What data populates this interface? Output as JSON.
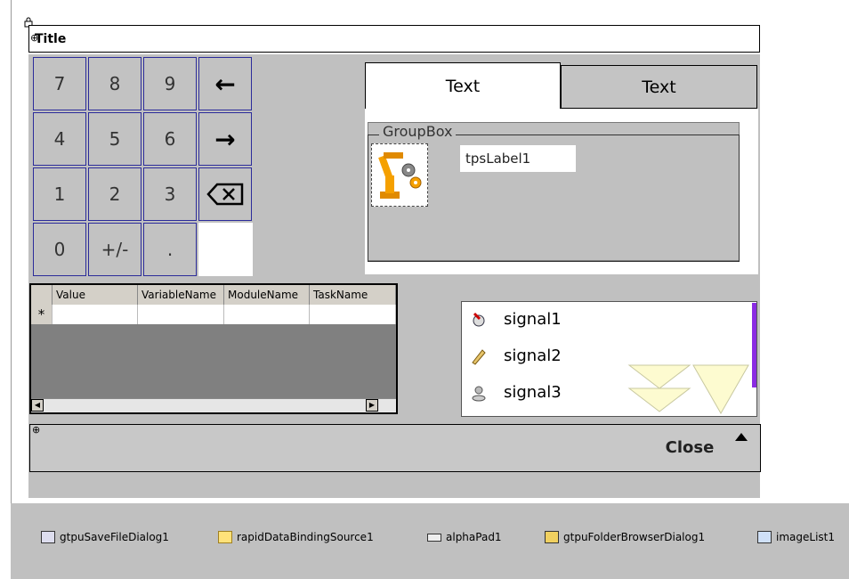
{
  "form": {
    "title": "Title"
  },
  "keypad": {
    "keys": [
      "7",
      "8",
      "9",
      "4",
      "5",
      "6",
      "1",
      "2",
      "3",
      "0",
      "+/-",
      "."
    ],
    "left_arrow_icon": "left-arrow-icon",
    "right_arrow_icon": "right-arrow-icon",
    "backspace_icon": "backspace-icon"
  },
  "tabs": [
    {
      "label": "Text"
    },
    {
      "label": "Text"
    }
  ],
  "groupbox": {
    "label": "GroupBox",
    "tps_label": "tpsLabel1"
  },
  "grid": {
    "columns": [
      "Value",
      "VariableName",
      "ModuleName",
      "TaskName"
    ],
    "new_row_marker": "*"
  },
  "signals": [
    {
      "label": "signal1",
      "icon": "signal-record-icon"
    },
    {
      "label": "signal2",
      "icon": "pencil-icon"
    },
    {
      "label": "signal3",
      "icon": "user-icon"
    }
  ],
  "bottom": {
    "close_label": "Close"
  },
  "tray": [
    {
      "label": "gtpuSaveFileDialog1",
      "icon": "save-dialog-icon"
    },
    {
      "label": "rapidDataBindingSource1",
      "icon": "binding-source-icon"
    },
    {
      "label": "alphaPad1",
      "icon": "keyboard-icon"
    },
    {
      "label": "gtpuFolderBrowserDialog1",
      "icon": "folder-dialog-icon"
    },
    {
      "label": "imageList1",
      "icon": "image-list-icon"
    }
  ]
}
